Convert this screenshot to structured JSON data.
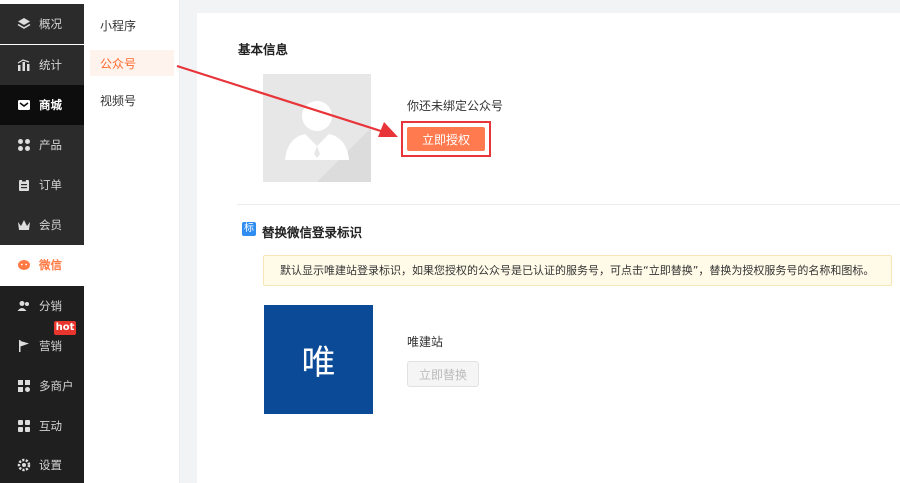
{
  "nav": {
    "items": [
      {
        "label": "概况",
        "icon": "layers-icon"
      },
      {
        "label": "统计",
        "icon": "chart-icon"
      },
      {
        "label": "商城",
        "icon": "mail-icon"
      },
      {
        "label": "产品",
        "icon": "grid-icon"
      },
      {
        "label": "订单",
        "icon": "clipboard-icon"
      },
      {
        "label": "会员",
        "icon": "crown-icon"
      },
      {
        "label": "微信",
        "icon": "wechat-icon"
      },
      {
        "label": "分销",
        "icon": "users-icon"
      },
      {
        "label": "营销",
        "icon": "flag-icon"
      },
      {
        "label": "多商户",
        "icon": "shop-icon"
      },
      {
        "label": "互动",
        "icon": "apps-icon"
      },
      {
        "label": "设置",
        "icon": "gear-icon"
      }
    ],
    "hot_badge": "hot"
  },
  "submenu": {
    "items": [
      "小程序",
      "公众号",
      "视频号"
    ],
    "active": "公众号"
  },
  "basic": {
    "title": "基本信息",
    "unbound": "你还未绑定公众号",
    "authorize": "立即授权"
  },
  "replace": {
    "tag": "标",
    "title": "替换微信登录标识",
    "notice": "默认显示唯建站登录标识，如果您授权的公众号是已认证的服务号，可点击“立即替换”，替换为授权服务号的名称和图标。",
    "logo_char": "唯",
    "site_name": "唯建站",
    "button": "立即替换"
  },
  "colors": {
    "accent": "#ff7a4f",
    "highlight": "#e8353a",
    "logo_bg": "#0b4a96",
    "tag": "#2f8cf0"
  }
}
